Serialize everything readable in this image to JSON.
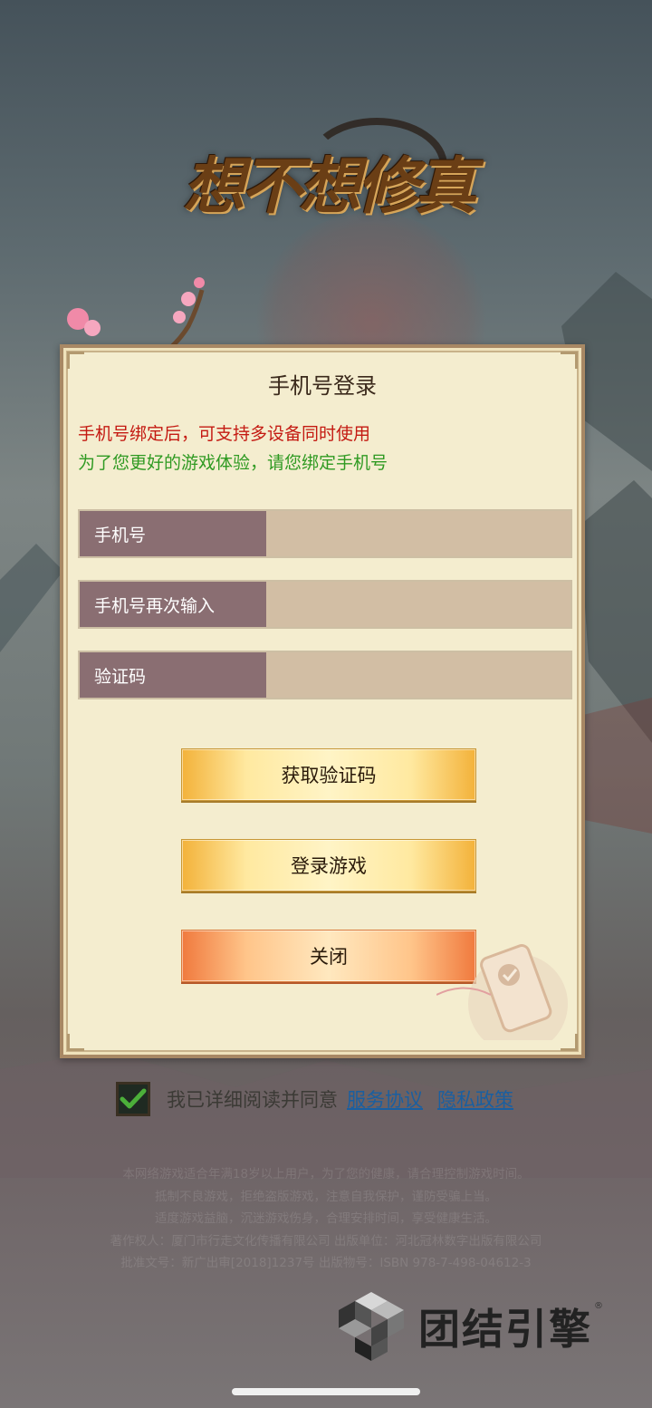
{
  "logo": {
    "text": "想不想修真"
  },
  "dialog": {
    "title": "手机号登录",
    "notice_red": "手机号绑定后，可支持多设备同时使用",
    "notice_green": "为了您更好的游戏体验，请您绑定手机号",
    "fields": [
      {
        "label": "手机号",
        "value": ""
      },
      {
        "label": "手机号再次输入",
        "value": ""
      },
      {
        "label": "验证码",
        "value": ""
      }
    ],
    "buttons": {
      "get_code": "获取验证码",
      "login": "登录游戏",
      "close": "关闭"
    }
  },
  "agreement": {
    "checked": true,
    "text": "我已详细阅读并同意",
    "service_link": "服务协议",
    "privacy_link": "隐私政策"
  },
  "footer": {
    "lines": [
      "本网络游戏适合年满18岁以上用户，为了您的健康，请合理控制游戏时间。",
      "抵制不良游戏，拒绝盗版游戏，注意自我保护，谨防受骗上当。",
      "适度游戏益脑，沉迷游戏伤身，合理安排时间，享受健康生活。",
      "著作权人：厦门市行走文化传播有限公司 出版单位：河北冠林数字出版有限公司",
      "批准文号：新广出审[2018]1237号 出版物号：ISBN 978-7-498-04612-3"
    ]
  },
  "engine": {
    "name": "团结引擎",
    "mark": "®"
  },
  "colors": {
    "dialog_bg": "#f4edcf",
    "label_bg": "#8a6e72",
    "input_bg": "#d2bea4",
    "notice_red": "#c41a12",
    "notice_green": "#2f9a22",
    "link": "#1a5fa0"
  }
}
